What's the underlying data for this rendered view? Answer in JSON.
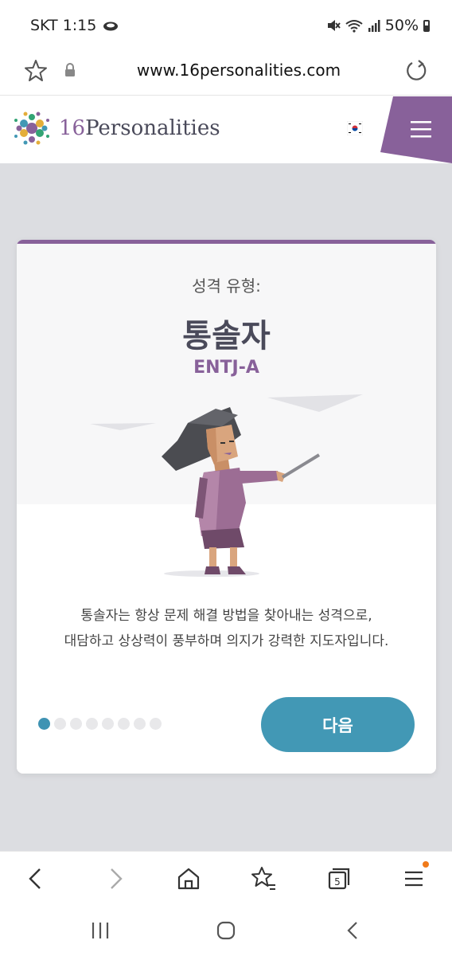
{
  "status_bar": {
    "carrier_time": "SKT 1:15",
    "battery": "50%"
  },
  "browser": {
    "url": "www.16personalities.com",
    "tab_count": "5"
  },
  "site": {
    "logo_number": "16",
    "logo_word": "Personalities",
    "accent_color": "#88619a"
  },
  "card": {
    "label": "성격 유형:",
    "title": "통솔자",
    "code": "ENTJ-A",
    "description_line1": "통솔자는 항상 문제 해결 방법을 찾아내는 성격으로,",
    "description_line2": "대담하고 상상력이 풍부하며 의지가 강력한 지도자입니다.",
    "next_label": "다음",
    "pager": {
      "total": 8,
      "current": 1
    },
    "button_color": "#4298b5"
  },
  "icons": {
    "status": [
      "cloud-icon",
      "mute-icon",
      "wifi-icon",
      "signal-icon",
      "battery-icon"
    ],
    "toolbar": [
      "back-icon",
      "forward-icon",
      "home-icon",
      "bookmarks-icon",
      "tabs-icon",
      "menu-icon"
    ],
    "nav": [
      "recents-icon",
      "home-circle-icon",
      "back-nav-icon"
    ]
  }
}
